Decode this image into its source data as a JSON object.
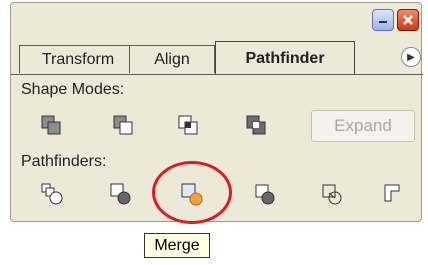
{
  "tabs": [
    {
      "label": "Transform"
    },
    {
      "label": "Align"
    },
    {
      "label": "Pathfinder"
    }
  ],
  "sections": {
    "shape_modes": "Shape Modes:",
    "pathfinders": "Pathfinders:"
  },
  "buttons": {
    "expand": "Expand"
  },
  "tooltip": "Merge"
}
